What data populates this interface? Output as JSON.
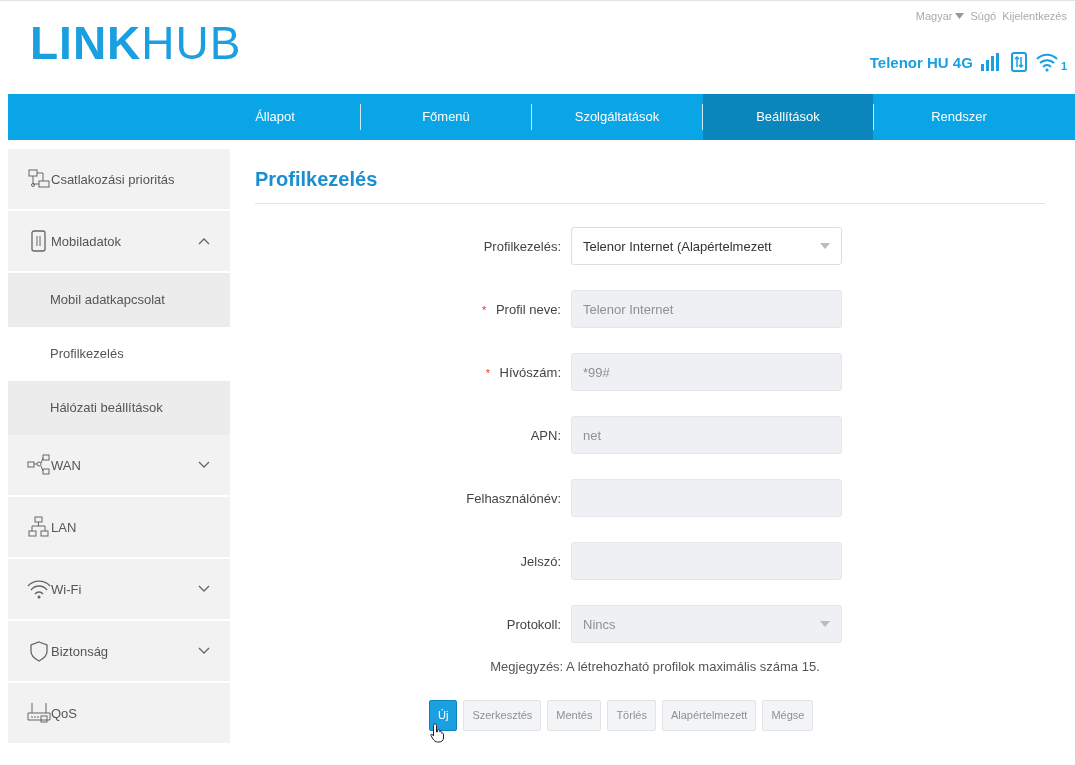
{
  "logo": {
    "bold": "LINK",
    "light": "HUB"
  },
  "top_links": {
    "language": "Magyar",
    "help": "Súgó",
    "logout": "Kijelentkezés"
  },
  "status": {
    "operator": "Telenor HU 4G",
    "wifi_clients": "1"
  },
  "tabs": [
    {
      "label": "Állapot",
      "selected": false
    },
    {
      "label": "Főmenü",
      "selected": false
    },
    {
      "label": "Szolgáltatások",
      "selected": false
    },
    {
      "label": "Beállítások",
      "selected": true
    },
    {
      "label": "Rendszer",
      "selected": false
    }
  ],
  "sidebar": {
    "items": [
      {
        "label": "Csatlakozási prioritás"
      },
      {
        "label": "Mobiladatok",
        "expanded": true,
        "children": [
          {
            "label": "Mobil adatkapcsolat",
            "selected": false
          },
          {
            "label": "Profilkezelés",
            "selected": true
          },
          {
            "label": "Hálózati beállítások",
            "selected": false
          }
        ]
      },
      {
        "label": "WAN",
        "expanded": false
      },
      {
        "label": "LAN"
      },
      {
        "label": "Wi-Fi",
        "expanded": false
      },
      {
        "label": "Biztonság",
        "expanded": false
      },
      {
        "label": "QoS"
      }
    ]
  },
  "page_title": "Profilkezelés",
  "required_marker": "*",
  "form": [
    {
      "kind": "select",
      "label": "Profilkezelés:",
      "required": false,
      "disabled": false,
      "value": "Telenor Internet (Alapértelmezett"
    },
    {
      "kind": "text",
      "label": "Profil neve:",
      "required": true,
      "disabled": true,
      "value": "Telenor Internet"
    },
    {
      "kind": "text",
      "label": "Hívószám:",
      "required": true,
      "disabled": true,
      "value": "*99#"
    },
    {
      "kind": "text",
      "label": "APN:",
      "required": false,
      "disabled": true,
      "value": "net"
    },
    {
      "kind": "text",
      "label": "Felhasználónév:",
      "required": false,
      "disabled": true
    },
    {
      "kind": "text",
      "label": "Jelszó:",
      "required": false,
      "disabled": true
    },
    {
      "kind": "select",
      "label": "Protokoll:",
      "required": false,
      "disabled": true,
      "value": "Nincs"
    }
  ],
  "note": "Megjegyzés: A létrehozható profilok maximális száma 15.",
  "buttons": [
    {
      "label": "Új",
      "disabled": false
    },
    {
      "label": "Szerkesztés",
      "disabled": true
    },
    {
      "label": "Mentés",
      "disabled": true
    },
    {
      "label": "Törlés",
      "disabled": true
    },
    {
      "label": "Alapértelmezett",
      "disabled": true
    },
    {
      "label": "Mégse",
      "disabled": true
    }
  ]
}
